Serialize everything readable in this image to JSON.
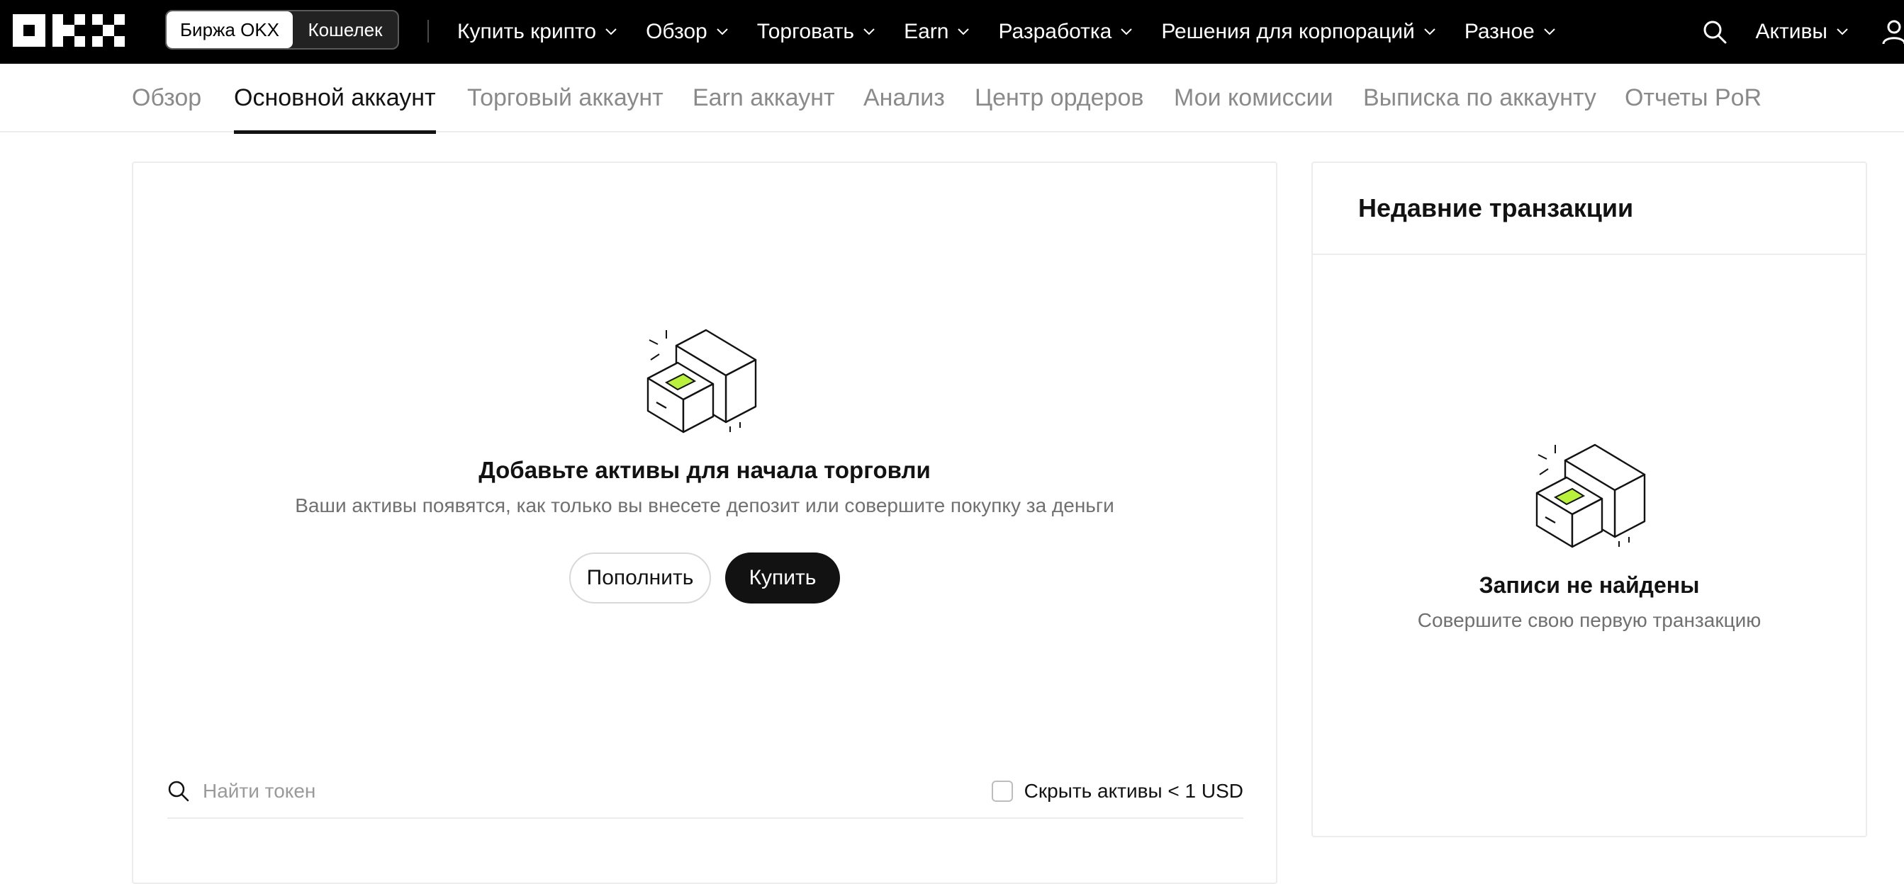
{
  "header": {
    "logo_alt": "OKX",
    "toggle": {
      "exchange": "Биржа OKX",
      "wallet": "Кошелек"
    },
    "nav": [
      {
        "label": "Купить крипто"
      },
      {
        "label": "Обзор"
      },
      {
        "label": "Торговать"
      },
      {
        "label": "Earn"
      },
      {
        "label": "Разработка"
      },
      {
        "label": "Решения для корпораций"
      },
      {
        "label": "Разное"
      }
    ],
    "assets_label": "Активы",
    "icons": [
      "search-icon",
      "chevron-down-icon",
      "user-icon"
    ]
  },
  "tabs": [
    {
      "label": "Обзор",
      "active": false
    },
    {
      "label": "Основной аккаунт",
      "active": true
    },
    {
      "label": "Торговый аккаунт",
      "active": false
    },
    {
      "label": "Earn аккаунт",
      "active": false
    },
    {
      "label": "Анализ",
      "active": false
    },
    {
      "label": "Центр ордеров",
      "active": false
    },
    {
      "label": "Мои комиссии",
      "active": false
    },
    {
      "label": "Выписка по аккаунту",
      "active": false
    },
    {
      "label": "Отчеты PoR",
      "active": false
    }
  ],
  "main": {
    "empty_title": "Добавьте активы для начала торговли",
    "empty_subtitle": "Ваши активы появятся, как только вы внесете депозит или совершите покупку за деньги",
    "deposit_label": "Пополнить",
    "buy_label": "Купить",
    "search_placeholder": "Найти токен",
    "hide_small_label": "Скрыть активы < 1 USD"
  },
  "side": {
    "title": "Недавние транзакции",
    "empty_title": "Записи не найдены",
    "empty_subtitle": "Совершите свою первую транзакцию"
  },
  "colors": {
    "topbar_bg": "#000000",
    "accent_lime": "#b8f23c",
    "text_primary": "#121212",
    "text_muted": "#8a8a8a",
    "border": "#ececec"
  }
}
